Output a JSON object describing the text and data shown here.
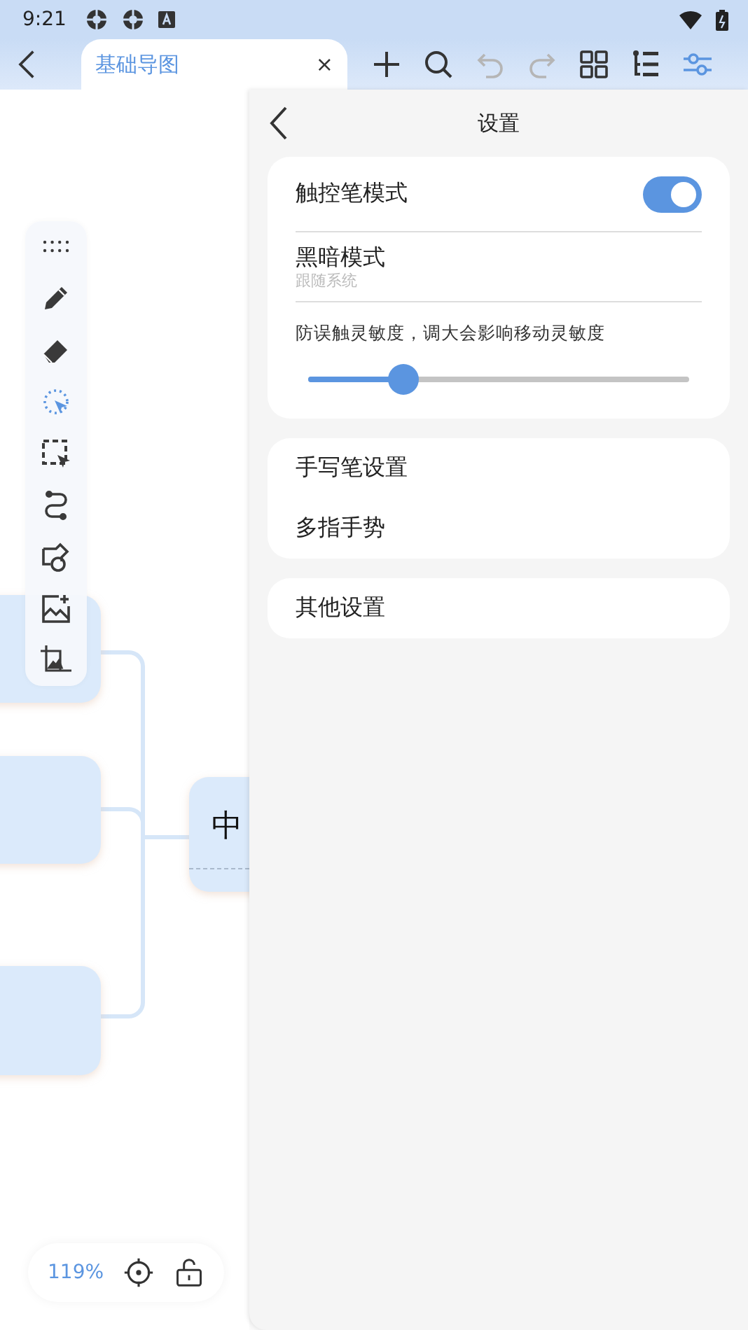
{
  "status_bar": {
    "time": "9:21"
  },
  "top_bar": {
    "tab": {
      "title": "基础导图",
      "close": "×",
      "selected": true
    },
    "actions": [
      {
        "kind": "add",
        "disabled": false,
        "selected": false
      },
      {
        "kind": "search",
        "disabled": false,
        "selected": false
      },
      {
        "kind": "undo",
        "disabled": true,
        "selected": false
      },
      {
        "kind": "redo",
        "disabled": true,
        "selected": false
      },
      {
        "kind": "grid",
        "disabled": false,
        "selected": false
      },
      {
        "kind": "outline",
        "disabled": false,
        "selected": false
      },
      {
        "kind": "settings",
        "disabled": false,
        "selected": true
      }
    ]
  },
  "canvas": {
    "tools": [
      {
        "kind": "handle",
        "selected": false
      },
      {
        "kind": "pen",
        "selected": false
      },
      {
        "kind": "eraser",
        "selected": false
      },
      {
        "kind": "lasso",
        "selected": true
      },
      {
        "kind": "rect-select",
        "selected": false
      },
      {
        "kind": "connector",
        "selected": false
      },
      {
        "kind": "shape",
        "selected": false
      },
      {
        "kind": "add-image",
        "selected": false
      },
      {
        "kind": "crop-image",
        "selected": false
      }
    ],
    "central_node": {
      "text": "中"
    },
    "zoom": "119%"
  },
  "settings": {
    "title": "设置",
    "stylus_mode": {
      "label": "触控笔模式",
      "on": true
    },
    "dark_mode": {
      "label": "黑暗模式",
      "value": "跟随系统"
    },
    "sensitivity": {
      "label": "防误触灵敏度，调大会影响移动灵敏度",
      "level": 0.25
    },
    "groups": [
      [
        "手写笔设置",
        "多指手势"
      ],
      [
        "其他设置"
      ]
    ]
  }
}
